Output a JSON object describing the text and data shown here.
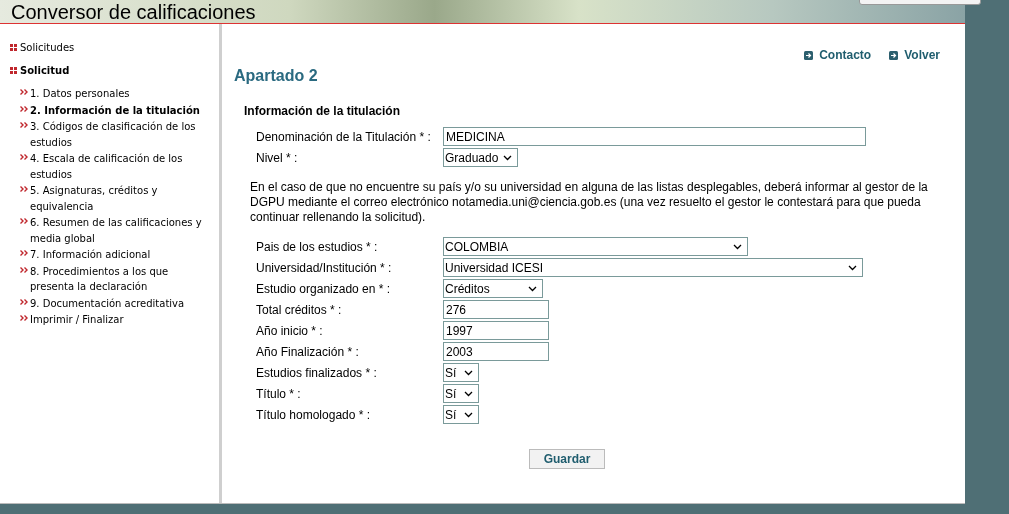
{
  "header": {
    "title": "Conversor de calificaciones"
  },
  "sidebar": {
    "sections": [
      {
        "label": "Solicitudes",
        "selected": false
      },
      {
        "label": "Solicitud",
        "selected": true,
        "items": [
          {
            "label": "1. Datos personales",
            "selected": false
          },
          {
            "label": "2. Información de la titulación",
            "selected": true
          },
          {
            "label": "3. Códigos de clasificación de los estudios",
            "selected": false
          },
          {
            "label": "4. Escala de calificación de los estudios",
            "selected": false
          },
          {
            "label": "5. Asignaturas, créditos y equivalencia",
            "selected": false
          },
          {
            "label": "6. Resumen de las calificaciones y media global",
            "selected": false
          },
          {
            "label": "7. Información adicional",
            "selected": false
          },
          {
            "label": "8. Procedimientos a los que presenta la declaración",
            "selected": false
          },
          {
            "label": "9. Documentación acreditativa",
            "selected": false
          },
          {
            "label": "Imprimir / Finalizar",
            "selected": false
          }
        ]
      }
    ]
  },
  "top_links": [
    "Contacto",
    "Volver"
  ],
  "page_title": "Apartado 2",
  "section_title": "Información de la titulación",
  "fields_top": [
    {
      "label": "Denominación de la Titulación * :",
      "kind": "text",
      "value": "MEDICINA"
    },
    {
      "label": "Nivel * :",
      "kind": "select",
      "value": "Graduado"
    }
  ],
  "notice": "En el caso de que no encuentre su país y/o su universidad en alguna de las listas desplegables, deberá informar al gestor de la DGPU mediante el correo electrónico notamedia.uni@ciencia.gob.es (una vez resuelto el gestor le contestará para que pueda continuar rellenando la solicitud).",
  "fields": [
    {
      "label": "Pais de los estudios * :",
      "kind": "select",
      "value": "COLOMBIA"
    },
    {
      "label": "Universidad/Institución * :",
      "kind": "select",
      "value": "Universidad ICESI"
    },
    {
      "label": "Estudio organizado en * :",
      "kind": "select",
      "value": "Créditos"
    },
    {
      "label": "Total créditos * :",
      "kind": "text",
      "value": "276"
    },
    {
      "label": "Año inicio * :",
      "kind": "text",
      "value": "1997"
    },
    {
      "label": "Año Finalización * :",
      "kind": "text",
      "value": "2003"
    },
    {
      "label": "Estudios finalizados * :",
      "kind": "select",
      "value": "Sí"
    },
    {
      "label": "Título * :",
      "kind": "select",
      "value": "Sí"
    },
    {
      "label": "Título homologado * :",
      "kind": "select",
      "value": "Sí"
    }
  ],
  "save_button": "Guardar"
}
